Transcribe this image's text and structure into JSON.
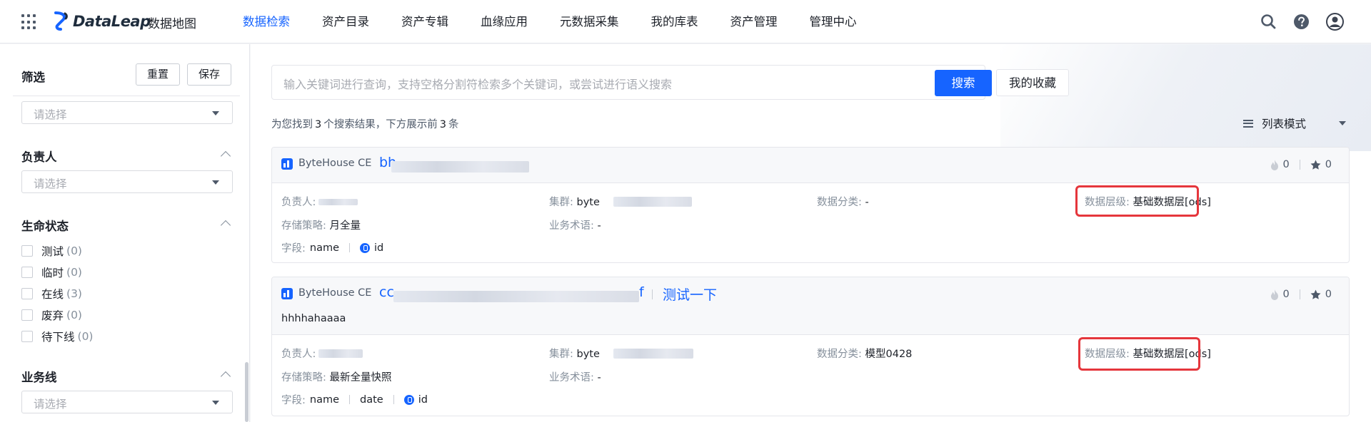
{
  "header": {
    "brand": "DataLeap",
    "product": "数据地图",
    "nav": [
      "数据检索",
      "资产目录",
      "资产专辑",
      "血缘应用",
      "元数据采集",
      "我的库表",
      "资产管理",
      "管理中心"
    ],
    "active_nav": "数据检索",
    "accent_color": "#1664ff"
  },
  "sidebar": {
    "title": "筛选",
    "reset_label": "重置",
    "save_label": "保存",
    "top_select_placeholder": "请选择",
    "owner": {
      "title": "负责人",
      "placeholder": "请选择"
    },
    "lifecycle": {
      "title": "生命状态",
      "options": [
        {
          "label": "测试",
          "count": "(0)"
        },
        {
          "label": "临时",
          "count": "(0)"
        },
        {
          "label": "在线",
          "count": "(3)"
        },
        {
          "label": "废弃",
          "count": "(0)"
        },
        {
          "label": "待下线",
          "count": "(0)"
        }
      ]
    },
    "business_line": {
      "title": "业务线",
      "placeholder": "请选择"
    }
  },
  "search": {
    "placeholder": "输入关键词进行查询，支持空格分割符检索多个关键词，或尝试进行语义搜索",
    "button_label": "搜索",
    "favorites_label": "我的收藏"
  },
  "results": {
    "summary_prefix": "为您找到",
    "total": "3",
    "summary_mid": "个搜索结果，下方展示前",
    "shown": "3",
    "summary_suffix": "条",
    "view_mode": "列表模式"
  },
  "cards": [
    {
      "source": "ByteHouse CE",
      "name_visible": "bh",
      "name_tail": "",
      "alias": "",
      "description": "",
      "hot": "0",
      "stars": "0",
      "owner_label": "负责人:",
      "cluster_label": "集群:",
      "cluster_value": "byte",
      "category_label": "数据分类:",
      "category_value": "-",
      "layer_label": "数据层级:",
      "layer_value": "基础数据层[ods]",
      "storage_label": "存储策略:",
      "storage_value": "月全量",
      "term_label": "业务术语:",
      "term_value": "-",
      "fields_label": "字段:",
      "fields": [
        "name",
        "id"
      ]
    },
    {
      "source": "ByteHouse CE",
      "name_visible": "cc",
      "name_tail": "f",
      "alias": "测试一下",
      "description": "hhhhahaaaa",
      "hot": "0",
      "stars": "0",
      "owner_label": "负责人:",
      "cluster_label": "集群:",
      "cluster_value": "byte",
      "category_label": "数据分类:",
      "category_value": "模型0428",
      "layer_label": "数据层级:",
      "layer_value": "基础数据层[ods]",
      "storage_label": "存储策略:",
      "storage_value": "最新全量快照",
      "term_label": "业务术语:",
      "term_value": "-",
      "fields_label": "字段:",
      "fields": [
        "name",
        "date",
        "id"
      ]
    }
  ]
}
